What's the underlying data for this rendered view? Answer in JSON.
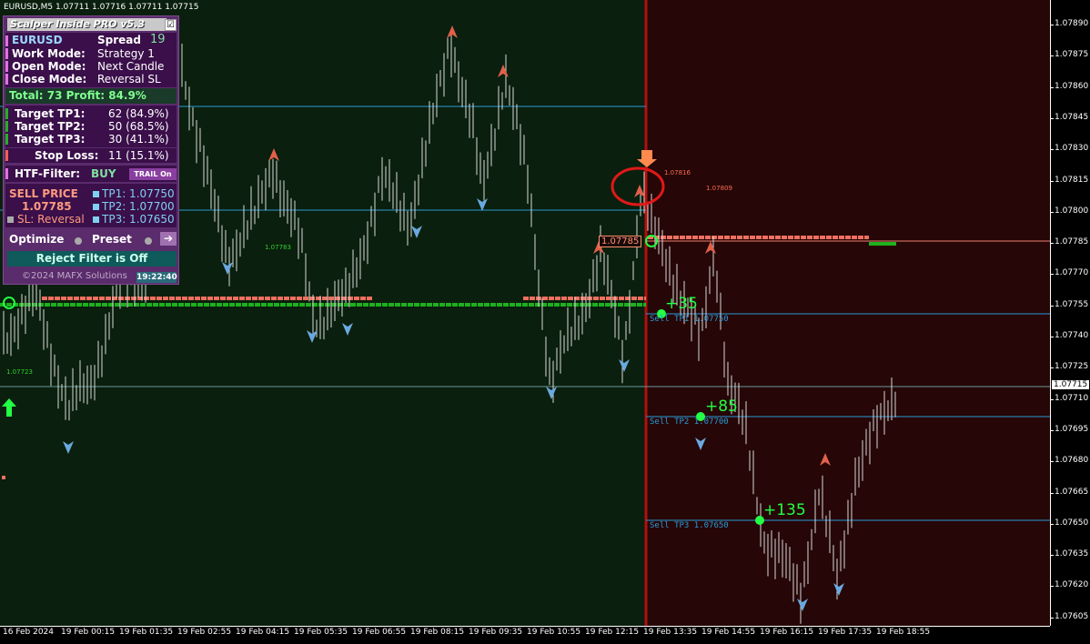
{
  "window": {
    "title": "EURUSD,M5  1.07711 1.07716 1.07711 1.07715"
  },
  "panel": {
    "title": "Scalper Inside PRO v5.3",
    "checkbox": "☑",
    "symbol": "EURUSD",
    "spread_label": "Spread",
    "spread_value": "19",
    "work_mode_label": "Work  Mode:",
    "work_mode_value": "Strategy 1",
    "open_mode_label": "Open  Mode:",
    "open_mode_value": "Next Candle",
    "close_mode_label": "Close Mode:",
    "close_mode_value": "Reversal SL",
    "total_text": "Total: 73  Profit: 84.9%",
    "targets": [
      {
        "label": "Target TP1:",
        "value": "62 (84.9%)"
      },
      {
        "label": "Target TP2:",
        "value": "50 (68.5%)"
      },
      {
        "label": "Target TP3:",
        "value": "30 (41.1%)"
      }
    ],
    "stop_loss_label": "Stop Loss:",
    "stop_loss_value": "11 (15.1%)",
    "htf_label": "HTF-Filter:",
    "htf_value": "BUY",
    "trail_button": "TRAIL On",
    "sell_price_label": "SELL PRICE",
    "sell_price_value": "1.07785",
    "sl_text": "SL: Reversal",
    "tp_lines": [
      "TP1: 1.07750",
      "TP2: 1.07700",
      "TP3: 1.07650"
    ],
    "optimize_label": "Optimize",
    "preset_label": "Preset",
    "reject_filter": "Reject Filter is Off",
    "copyright": "©2024 MAFX Solutions",
    "clock": "19:22:40"
  },
  "chart": {
    "entry_label": "1.07785",
    "profit_labels": [
      "+35",
      "+85",
      "+135"
    ],
    "tp_line_labels": [
      "Sell TP1 1.07750",
      "Sell TP2 1.07700",
      "Sell TP3 1.07650"
    ],
    "signal_prices": [
      "1.07816",
      "1.07809"
    ],
    "green_prices": [
      "1.07783",
      "1.07723"
    ],
    "current_price": "1.07715",
    "colors": {
      "buy_zone": "#0a1f0d",
      "sell_zone": "#260606",
      "bear_arrow": "#e0604a",
      "bull_arrow": "#6aa9e0",
      "tp_line": "#2a9ad8",
      "green": "#22ff44"
    }
  },
  "y_axis": [
    "1.07890",
    "1.07875",
    "1.07860",
    "1.07845",
    "1.07830",
    "1.07815",
    "1.07800",
    "1.07785",
    "1.07770",
    "1.07755",
    "1.07740",
    "1.07725",
    "1.07710",
    "1.07695",
    "1.07680",
    "1.07665",
    "1.07650",
    "1.07635",
    "1.07620",
    "1.07605"
  ],
  "x_axis": [
    "16 Feb 2024",
    "19 Feb 00:15",
    "19 Feb 01:35",
    "19 Feb 02:55",
    "19 Feb 04:15",
    "19 Feb 05:35",
    "19 Feb 06:55",
    "19 Feb 08:15",
    "19 Feb 09:35",
    "19 Feb 10:55",
    "19 Feb 12:15",
    "19 Feb 13:35",
    "19 Feb 14:55",
    "19 Feb 16:15",
    "19 Feb 17:35",
    "19 Feb 18:55"
  ]
}
